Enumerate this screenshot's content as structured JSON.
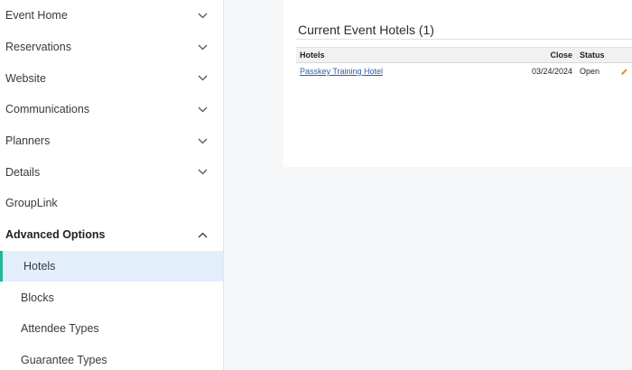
{
  "sidebar": {
    "items": [
      {
        "label": "Event Home",
        "chevron": "down"
      },
      {
        "label": "Reservations",
        "chevron": "down"
      },
      {
        "label": "Website",
        "chevron": "down"
      },
      {
        "label": "Communications",
        "chevron": "down"
      },
      {
        "label": "Planners",
        "chevron": "down"
      },
      {
        "label": "Details",
        "chevron": "down"
      },
      {
        "label": "GroupLink",
        "chevron": "none"
      },
      {
        "label": "Advanced Options",
        "chevron": "up"
      }
    ],
    "sub_items": [
      {
        "label": "Hotels",
        "active": true
      },
      {
        "label": "Blocks",
        "active": false
      },
      {
        "label": "Attendee Types",
        "active": false
      },
      {
        "label": "Guarantee Types",
        "active": false
      }
    ],
    "active_accent": "#1fb89a"
  },
  "main": {
    "title": "Current Event Hotels (1)",
    "table": {
      "headers": {
        "hotels": "Hotels",
        "close": "Close",
        "status": "Status"
      },
      "rows": [
        {
          "hotel": "Passkey Training Hotel",
          "close": "03/24/2024",
          "status": "Open",
          "action_icon": "pencil-icon"
        }
      ]
    },
    "link_color": "#2a5ea8",
    "edit_icon_color": "#e08a1e"
  }
}
